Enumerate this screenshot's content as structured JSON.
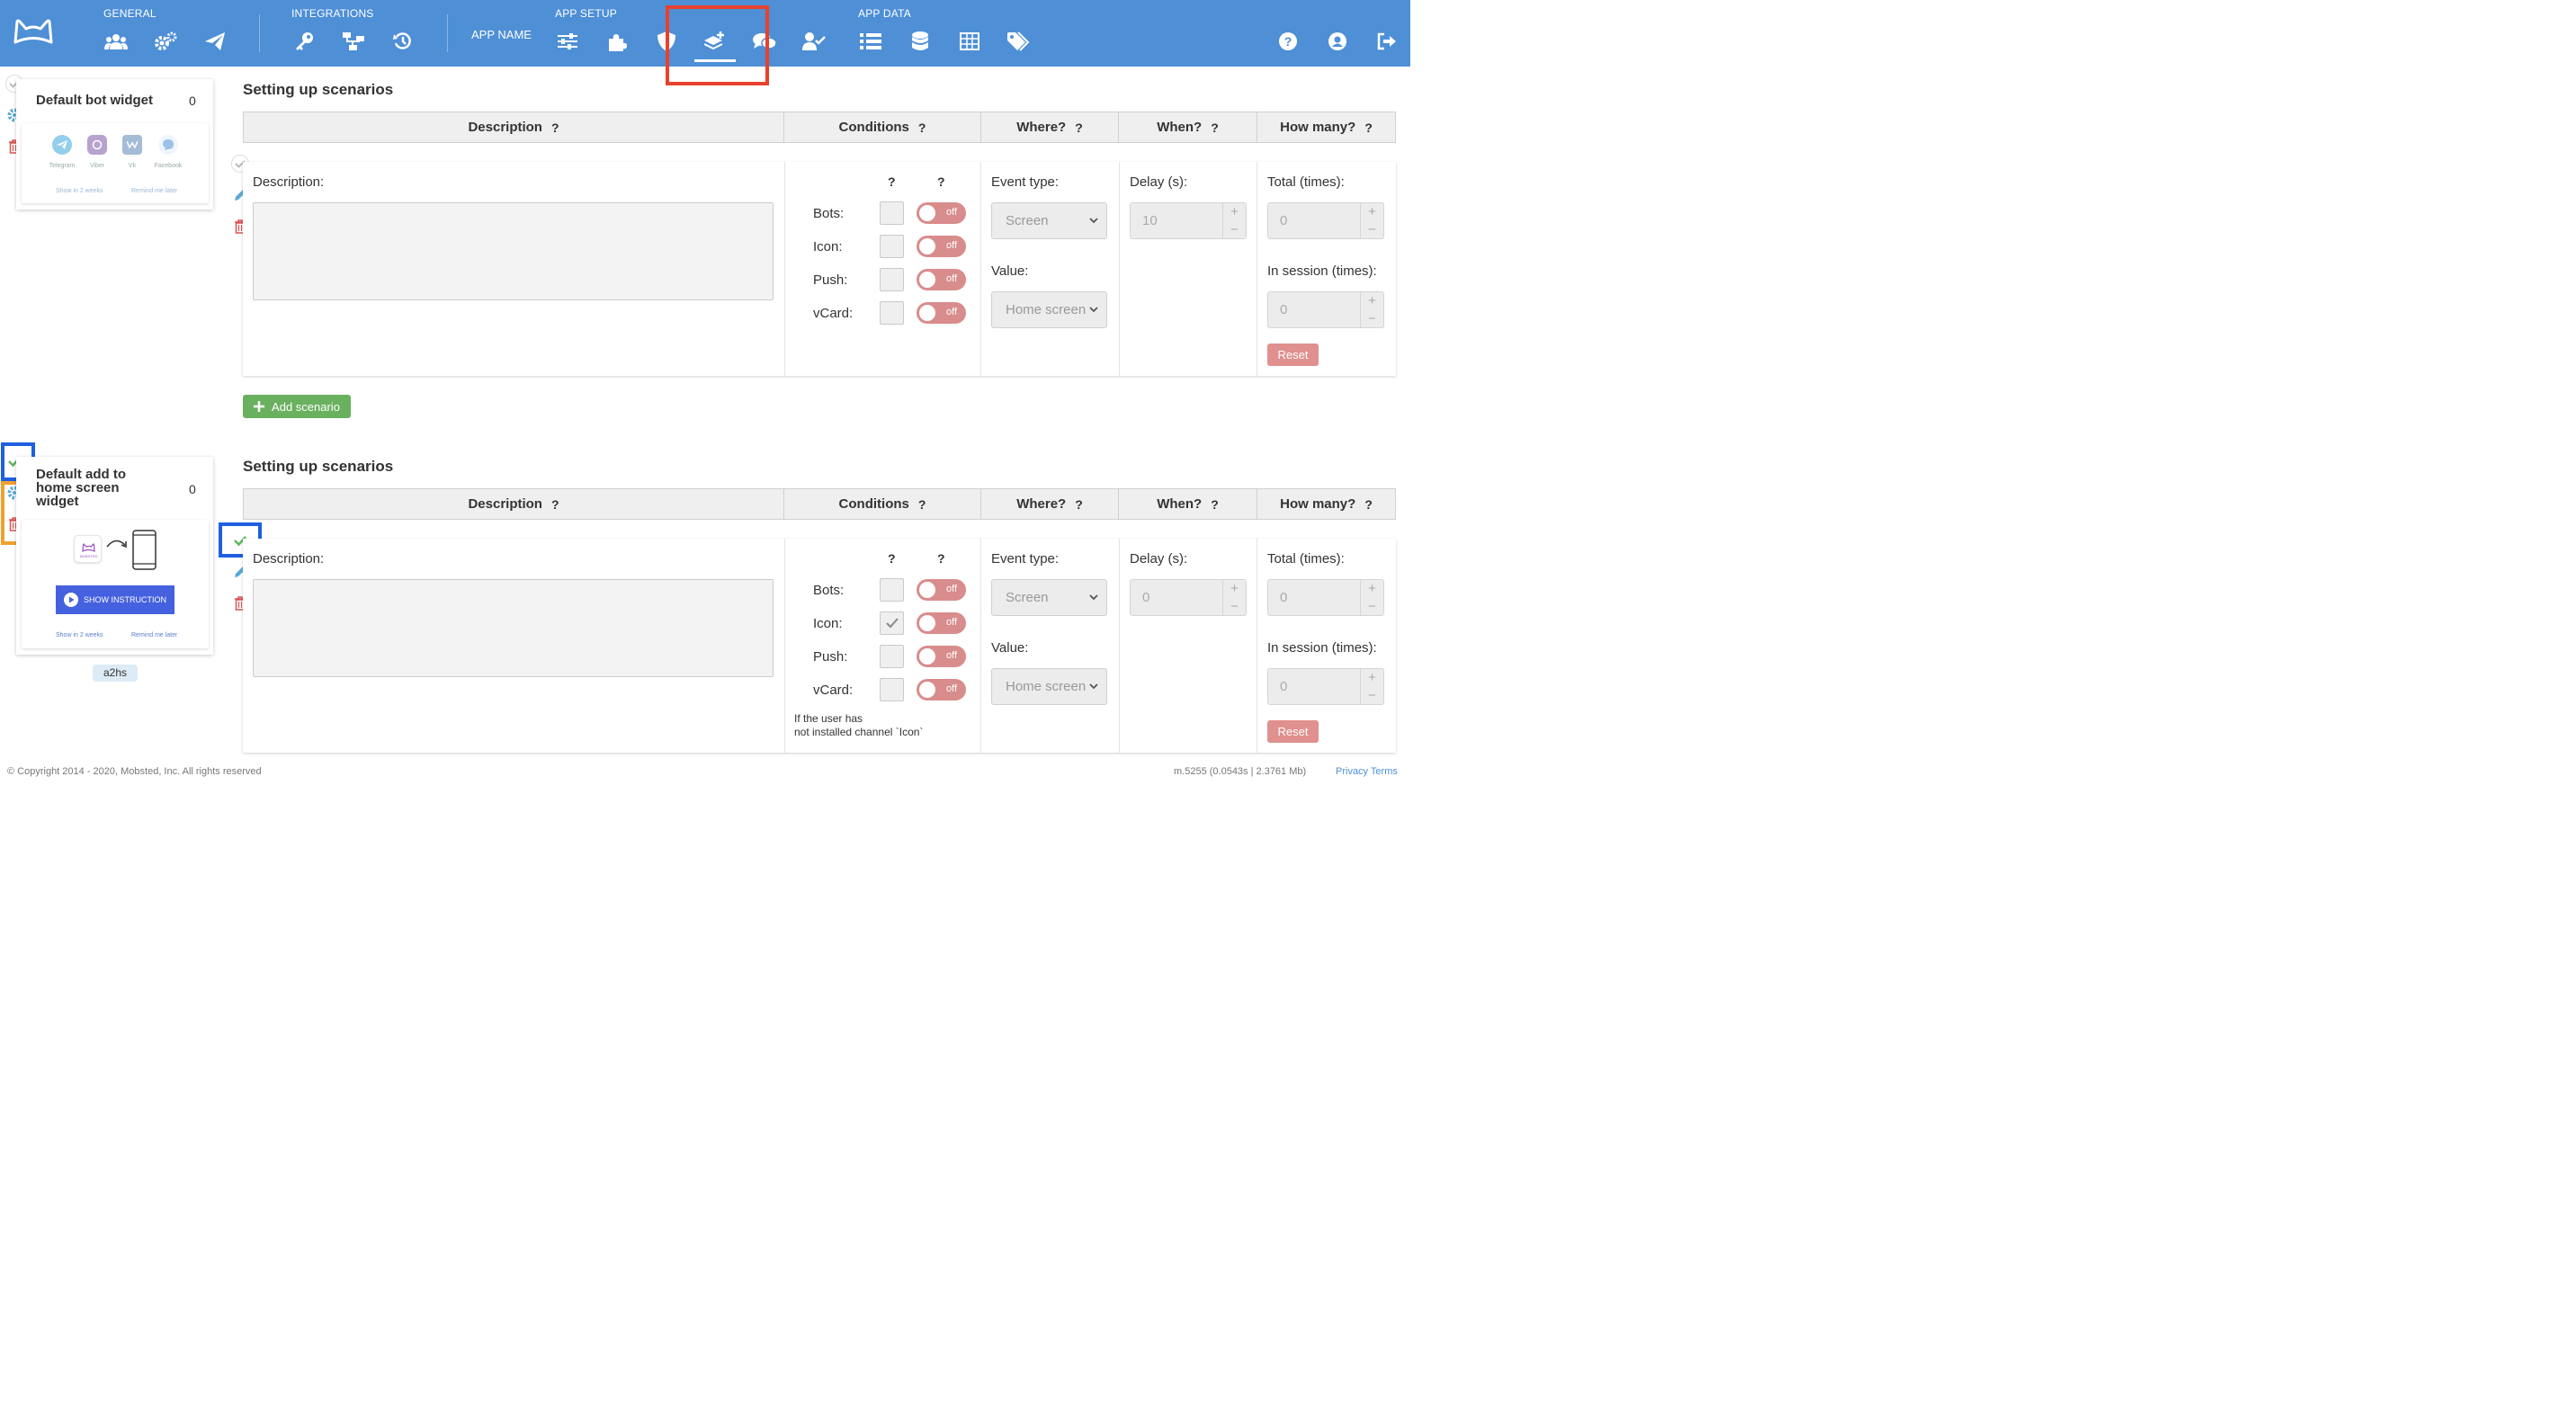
{
  "nav": {
    "sections": {
      "general": "GENERAL",
      "integrations": "INTEGRATIONS",
      "app_setup": "APP SETUP",
      "app_data": "APP DATA"
    },
    "app_name": "APP NAME",
    "icons": [
      "users-icon",
      "gears-icon",
      "paper-plane-icon",
      "key-icon",
      "network-icon",
      "history-icon",
      "sliders-icon",
      "puzzle-icon",
      "shield-icon",
      "layer-plus-icon",
      "comments-icon",
      "user-check-icon",
      "list-icon",
      "database-icon",
      "table-icon",
      "tags-icon",
      "help-icon",
      "user-circle-icon",
      "sign-out-icon"
    ],
    "active_icon": "layer-plus-icon",
    "bg_color": "#4e8fd6"
  },
  "widgets": [
    {
      "title": "Default bot widget",
      "count": "0",
      "messengers": [
        "Telegram",
        "Viber",
        "Vk",
        "Facebook"
      ],
      "link_left": "Show in 2 weeks",
      "link_right": "Remind me later"
    },
    {
      "title": "Default add to home screen widget",
      "count": "0",
      "logo_text": "MOBSTED",
      "button": "SHOW INSTRUCTION",
      "link_left": "Show in 2 weeks",
      "link_right": "Remind me later",
      "tag": "a2hs"
    }
  ],
  "scenarios": [
    {
      "title": "Setting up scenarios",
      "headers": [
        "Description",
        "Conditions",
        "Where?",
        "When?",
        "How many?"
      ],
      "help_mark": "?",
      "description_label": "Description:",
      "channels": [
        {
          "name": "Bots:",
          "checked": false,
          "toggle": "off"
        },
        {
          "name": "Icon:",
          "checked": false,
          "toggle": "off"
        },
        {
          "name": "Push:",
          "checked": false,
          "toggle": "off"
        },
        {
          "name": "vCard:",
          "checked": false,
          "toggle": "off"
        }
      ],
      "event_type_label": "Event type:",
      "event_type": "Screen",
      "value_label": "Value:",
      "value": "Home screen",
      "delay_label": "Delay (s):",
      "delay": "10",
      "total_label": "Total (times):",
      "total": "0",
      "session_label": "In session (times):",
      "session": "0",
      "reset": "Reset",
      "hint": ""
    },
    {
      "title": "Setting up scenarios",
      "headers": [
        "Description",
        "Conditions",
        "Where?",
        "When?",
        "How many?"
      ],
      "help_mark": "?",
      "description_label": "Description:",
      "channels": [
        {
          "name": "Bots:",
          "checked": false,
          "toggle": "off"
        },
        {
          "name": "Icon:",
          "checked": true,
          "toggle": "off"
        },
        {
          "name": "Push:",
          "checked": false,
          "toggle": "off"
        },
        {
          "name": "vCard:",
          "checked": false,
          "toggle": "off"
        }
      ],
      "event_type_label": "Event type:",
      "event_type": "Screen",
      "value_label": "Value:",
      "value": "Home screen",
      "delay_label": "Delay (s):",
      "delay": "0",
      "total_label": "Total (times):",
      "total": "0",
      "session_label": "In session (times):",
      "session": "0",
      "reset": "Reset",
      "hint_line1": "If the user has",
      "hint_line2": "not installed channel `Icon`"
    }
  ],
  "add_scenario": "Add scenario",
  "footer": {
    "copyright": "© Copyright 2014 - 2020, Mobsted, Inc. All rights reserved",
    "build": "m.5255 (0.0543s | 2.3761 Mb)",
    "links": "Privacy   Terms"
  },
  "colors": {
    "highlight_red": "#e8412c",
    "highlight_blue": "#1f5fe0",
    "highlight_orange": "#f0a030",
    "toggle_off": "#d98c8c",
    "add_green": "#6ab15f",
    "reset_red": "#e0908e"
  }
}
